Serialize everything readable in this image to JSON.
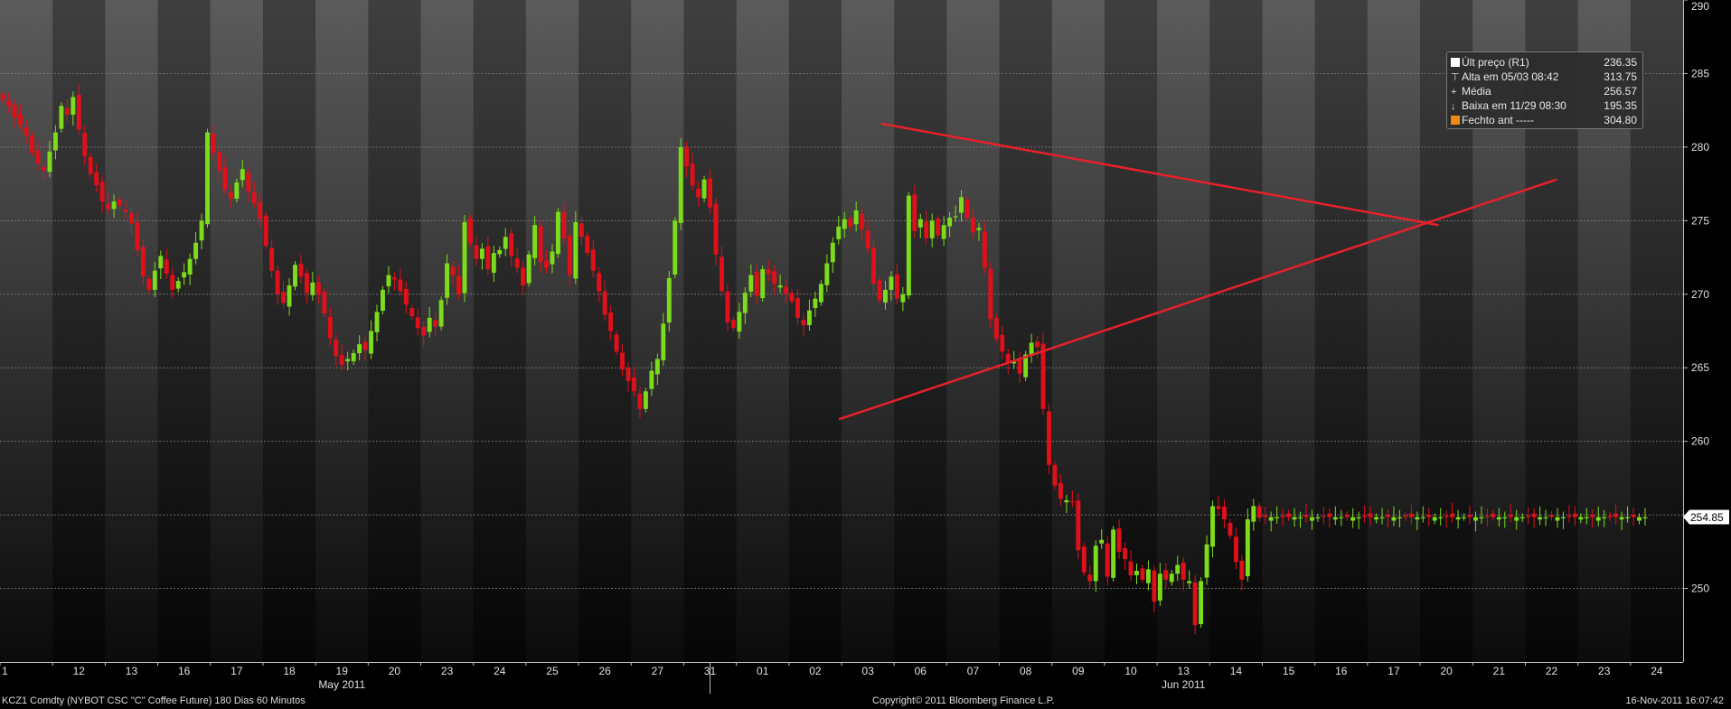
{
  "chart_data": {
    "type": "candlestick",
    "ylim": [
      245,
      290
    ],
    "yticks": [
      250,
      255,
      260,
      265,
      270,
      275,
      280,
      285,
      290
    ],
    "day_labels": [
      "1",
      "12",
      "13",
      "16",
      "17",
      "18",
      "19",
      "20",
      "23",
      "24",
      "25",
      "26",
      "27",
      "31",
      "01",
      "02",
      "03",
      "06",
      "07",
      "08",
      "09",
      "10",
      "13",
      "14",
      "15",
      "16",
      "17",
      "20",
      "21",
      "22",
      "23",
      "24"
    ],
    "month_labels": [
      {
        "text": "May 2011",
        "day_index": 6.5
      },
      {
        "text": "Jun 2011",
        "day_index": 22.5
      }
    ],
    "last_price_tag": "254.85",
    "last_price": 254.85,
    "bars_per_day": 9,
    "closes": [
      283.2,
      282.8,
      282.0,
      281.5,
      280.8,
      279.6,
      278.9,
      278.4,
      279.7,
      281.0,
      282.8,
      282.2,
      283.4,
      281.2,
      279.4,
      278.2,
      277.4,
      276.3,
      275.8,
      276.3,
      276.0,
      275.6,
      274.8,
      273.0,
      271.2,
      270.3,
      271.6,
      272.6,
      271.4,
      270.3,
      270.9,
      271.5,
      272.4,
      273.5,
      275.0,
      281.0,
      279.6,
      278.4,
      277.1,
      276.5,
      277.6,
      278.5,
      277.0,
      276.2,
      275.1,
      273.3,
      271.6,
      270.0,
      269.4,
      270.6,
      272.0,
      271.2,
      270.1,
      270.8,
      270.0,
      268.7,
      267.0,
      265.8,
      265.2,
      265.6,
      266.0,
      266.6,
      266.2,
      267.5,
      268.8,
      270.3,
      271.3,
      271.0,
      270.2,
      269.3,
      268.5,
      267.7,
      267.2,
      268.4,
      267.8,
      269.6,
      272.1,
      271.3,
      270.0,
      274.9,
      273.5,
      272.4,
      273.1,
      271.7,
      272.8,
      273.0,
      273.9,
      272.6,
      271.8,
      270.6,
      272.7,
      274.7,
      272.2,
      271.8,
      272.9,
      275.6,
      273.8,
      271.3,
      274.9,
      273.9,
      272.8,
      271.6,
      270.2,
      268.6,
      267.5,
      266.1,
      264.9,
      264.1,
      263.4,
      262.2,
      263.4,
      264.8,
      265.6,
      268.0,
      271.1,
      275.0,
      280.0,
      278.7,
      277.4,
      276.6,
      277.8,
      275.9,
      272.7,
      270.2,
      268.1,
      267.7,
      268.8,
      270.1,
      271.3,
      269.9,
      271.7,
      271.4,
      270.7,
      270.6,
      270.0,
      269.5,
      268.4,
      267.9,
      268.9,
      269.7,
      270.7,
      272.1,
      273.5,
      274.6,
      275.1,
      274.6,
      275.7,
      274.4,
      273.1,
      270.7,
      269.6,
      270.3,
      271.2,
      269.7,
      270.0,
      276.7,
      274.3,
      275.1,
      273.8,
      275.0,
      274.0,
      274.7,
      275.2,
      275.3,
      276.6,
      275.2,
      274.2,
      274.5,
      271.8,
      268.3,
      267.0,
      266.1,
      265.3,
      265.4,
      264.6,
      265.9,
      266.7,
      266.4,
      262.2,
      258.4,
      257.0,
      256.1,
      256.0,
      255.9,
      252.6,
      251.1,
      250.5,
      252.9,
      253.3,
      250.8,
      254.0,
      252.5,
      252.0,
      250.9,
      251.2,
      250.6,
      251.3,
      249.1,
      251.0,
      250.6,
      251.0,
      251.6,
      250.6,
      250.5,
      247.5,
      250.5,
      253.0,
      255.6,
      255.4,
      254.7,
      253.6,
      251.8,
      250.6,
      254.7,
      255.6,
      254.8,
      254.85,
      254.85,
      254.85,
      254.85,
      254.85,
      254.85,
      254.85,
      254.85,
      254.85,
      254.85,
      254.85,
      254.85,
      254.85,
      254.85,
      254.85,
      254.85,
      254.85,
      254.85,
      254.85,
      254.85,
      254.85,
      254.85,
      254.85,
      254.85,
      254.85,
      254.85,
      254.85,
      254.85,
      254.85,
      254.85,
      254.85,
      254.85,
      254.85,
      254.85,
      254.85,
      254.85,
      254.85,
      254.85,
      254.85,
      254.85,
      254.85,
      254.85,
      254.85,
      254.85,
      254.85,
      254.85,
      254.85,
      254.85,
      254.85,
      254.85,
      254.85,
      254.85,
      254.85,
      254.85,
      254.85,
      254.85,
      254.85,
      254.85,
      254.85,
      254.85,
      254.85,
      254.85,
      254.85,
      254.85,
      254.85,
      254.85,
      254.85,
      254.85,
      254.85,
      254.85,
      254.85,
      254.85,
      254.85,
      254.85,
      254.85,
      254.85,
      254.85
    ],
    "trendlines": [
      {
        "from": [
          16.75,
          281.6
        ],
        "to": [
          27.35,
          274.7
        ]
      },
      {
        "from": [
          15.95,
          261.5
        ],
        "to": [
          29.6,
          277.8
        ]
      }
    ],
    "up_color": "#7cdc1c",
    "down_color": "#e0101a",
    "trend_color": "#e8202a"
  },
  "legend": {
    "rows": [
      {
        "icon": "square",
        "label": "Últ preço (R1)",
        "value": "236.35"
      },
      {
        "icon": "high",
        "label": "Alta em 05/03 08:42",
        "value": "313.75"
      },
      {
        "icon": "avg",
        "label": "Média",
        "value": "256.57"
      },
      {
        "icon": "low",
        "label": "Baixa em 11/29 08:30",
        "value": "195.35"
      },
      {
        "icon": "orange",
        "label": "Fechto ant -----",
        "value": "304.80"
      }
    ]
  },
  "footer": {
    "left": "KCZ1 Comdty (NYBOT CSC \"C\" Coffee Future) 180 Dias 60 Minutos",
    "center": "Copyright© 2011 Bloomberg Finance L.P.",
    "right": "16-Nov-2011 16:07:42"
  }
}
